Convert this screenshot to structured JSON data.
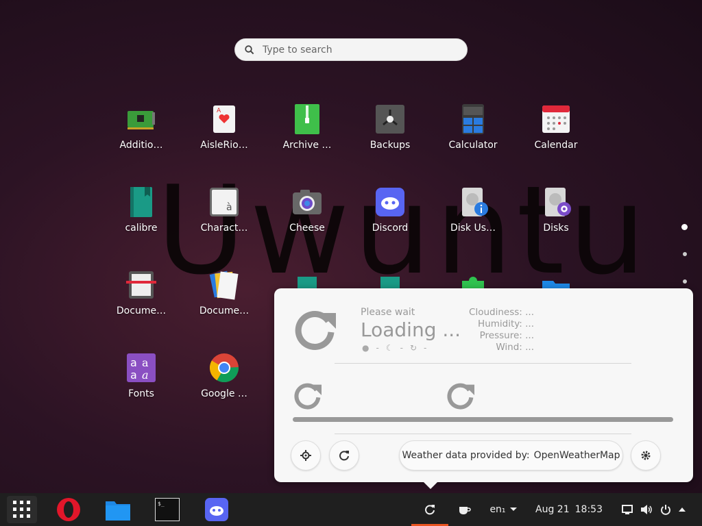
{
  "search": {
    "placeholder": "Type to search"
  },
  "watermark": "Uwuntu",
  "apps": [
    {
      "label": "Additio…",
      "icon": "circuit-board-icon"
    },
    {
      "label": "AisleRio…",
      "icon": "playing-card-icon"
    },
    {
      "label": "Archive …",
      "icon": "archive-zip-icon"
    },
    {
      "label": "Backups",
      "icon": "safe-icon"
    },
    {
      "label": "Calculator",
      "icon": "calculator-icon"
    },
    {
      "label": "Calendar",
      "icon": "calendar-icon"
    },
    {
      "label": "calibre",
      "icon": "book-icon"
    },
    {
      "label": "Charact…",
      "icon": "character-map-icon"
    },
    {
      "label": "Cheese",
      "icon": "camera-icon"
    },
    {
      "label": "Discord",
      "icon": "discord-icon"
    },
    {
      "label": "Disk Us…",
      "icon": "disk-usage-icon"
    },
    {
      "label": "Disks",
      "icon": "disks-icon"
    },
    {
      "label": "Docume…",
      "icon": "document-scanner-icon"
    },
    {
      "label": "Docume…",
      "icon": "document-viewer-icon"
    },
    {
      "label": "Fonts",
      "icon": "fonts-icon"
    },
    {
      "label": "Google …",
      "icon": "chrome-icon"
    }
  ],
  "weather": {
    "please_wait": "Please wait",
    "loading": "Loading ...",
    "small_status": [
      "-",
      "-",
      "-"
    ],
    "details": [
      {
        "label": "Cloudiness:",
        "value": "..."
      },
      {
        "label": "Humidity:",
        "value": "..."
      },
      {
        "label": "Pressure:",
        "value": "..."
      },
      {
        "label": "Wind:",
        "value": "..."
      }
    ],
    "provider_prefix": "Weather data provided by:",
    "provider_name": "OpenWeatherMap"
  },
  "taskbar": {
    "keyboard_layout": "en₁",
    "date": "Aug 21",
    "time": "18:53"
  },
  "colors": {
    "accent": "#e95420",
    "popup_bg": "#f7f7f7"
  }
}
